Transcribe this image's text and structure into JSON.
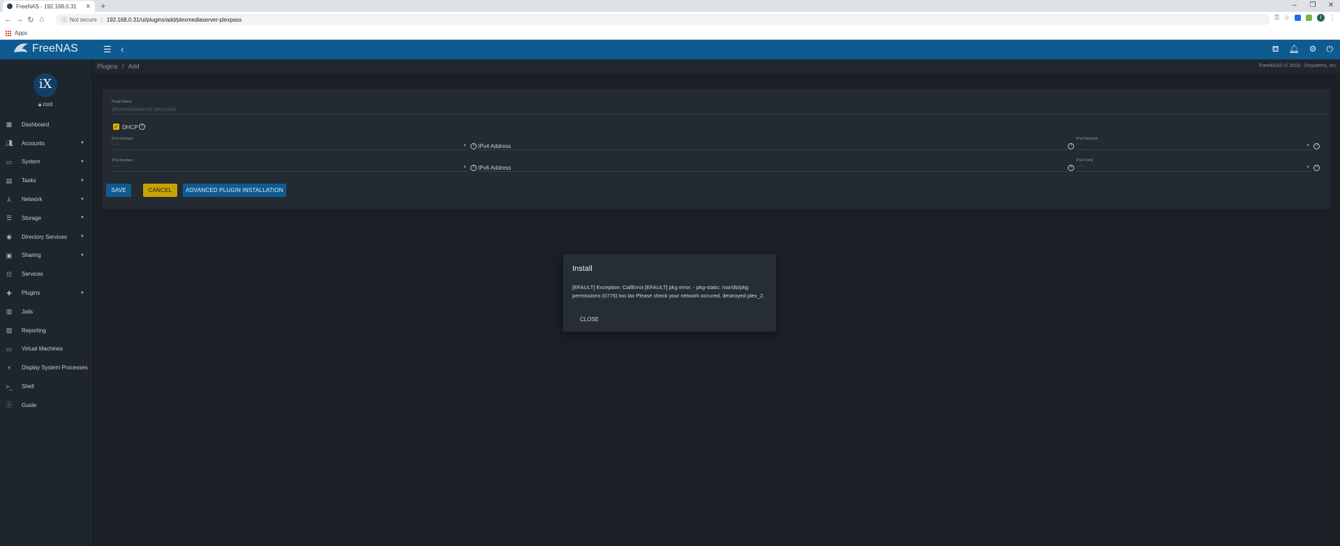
{
  "browser": {
    "tab_title": "FreeNAS - 192.168.0.31",
    "not_secure": "Not secure",
    "url": "192.168.0.31/ui/plugins/add/plexmediaserver-plexpass",
    "bookmarks_apps": "Apps"
  },
  "header": {
    "brand": "FreeNAS"
  },
  "breadcrumb": {
    "parent": "Plugins",
    "separator": "/",
    "current": "Add"
  },
  "copyright": "FreeNAS® © 2019 - iXsystems, Inc.",
  "sidebar": {
    "logo_text": "iX",
    "user": "root",
    "items": [
      {
        "label": "Dashboard",
        "icon": "dashboard-icon",
        "caret": false
      },
      {
        "label": "Accounts",
        "icon": "accounts-icon",
        "caret": true
      },
      {
        "label": "System",
        "icon": "system-icon",
        "caret": true
      },
      {
        "label": "Tasks",
        "icon": "tasks-icon",
        "caret": true
      },
      {
        "label": "Network",
        "icon": "network-icon",
        "caret": true
      },
      {
        "label": "Storage",
        "icon": "storage-icon",
        "caret": true
      },
      {
        "label": "Directory Services",
        "icon": "directory-services-icon",
        "caret": true
      },
      {
        "label": "Sharing",
        "icon": "sharing-icon",
        "caret": true
      },
      {
        "label": "Services",
        "icon": "services-icon",
        "caret": false
      },
      {
        "label": "Plugins",
        "icon": "plugins-icon",
        "caret": true
      },
      {
        "label": "Jails",
        "icon": "jails-icon",
        "caret": false
      },
      {
        "label": "Reporting",
        "icon": "reporting-icon",
        "caret": false
      },
      {
        "label": "Virtual Machines",
        "icon": "virtual-machines-icon",
        "caret": false
      },
      {
        "label": "Display System Processes",
        "icon": "processes-icon",
        "caret": false
      },
      {
        "label": "Shell",
        "icon": "shell-icon",
        "caret": false
      },
      {
        "label": "Guide",
        "icon": "guide-icon",
        "caret": false
      }
    ]
  },
  "form": {
    "plugin_name_label": "Plugin Name",
    "plugin_name_value": "plexmediaserver-plexpass",
    "dhcp_label": "DHCP",
    "dhcp_checked": true,
    "ipv4_interface_label": "IPv4 Interface",
    "ipv4_address_label": "IPv4 Address",
    "ipv4_netmask_label": "IPv4 Netmask",
    "ipv6_interface_label": "IPv6 Interface",
    "ipv6_address_label": "IPv6 Address",
    "ipv6_prefix_label": "IPv6 Prefix",
    "empty_value": "------",
    "save_label": "SAVE",
    "cancel_label": "CANCEL",
    "advanced_label": "ADVANCED PLUGIN INSTALLATION"
  },
  "dialog": {
    "title": "Install",
    "message": "[EFAULT] Exception: CallError:[EFAULT] pkg error: - pkg-static: /var/db/pkg permissions (0775) too lax Please check your network occured, destroyed plex_2.",
    "close_label": "CLOSE"
  },
  "colors": {
    "header": "#0e5b92",
    "background": "#1b2027",
    "sidebar": "#1f252c",
    "accent_yellow": "#c8a200"
  }
}
